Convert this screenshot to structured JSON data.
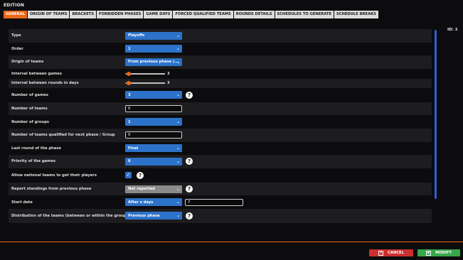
{
  "window": {
    "title": "EDITION",
    "id_text": "ID: 2"
  },
  "tabs": [
    {
      "label": "GENERAL",
      "active": true
    },
    {
      "label": "ORIGIN OF TEAMS"
    },
    {
      "label": "BRACKETS"
    },
    {
      "label": "FORBIDDEN PHASES"
    },
    {
      "label": "GAME DAYS"
    },
    {
      "label": "FORCED QUALIFIED TEAMS"
    },
    {
      "label": "ROUNDS DETAILS"
    },
    {
      "label": "SCHEDULES TO GENERATE"
    },
    {
      "label": "SCHEDULE BREAKS"
    }
  ],
  "form": {
    "type": {
      "label": "Type",
      "value": "Playoffs"
    },
    "order": {
      "label": "Order",
      "value": "1"
    },
    "origin": {
      "label": "Origin of teams",
      "value": "From previous phase (..."
    },
    "interval_games": {
      "label": "Interval between games",
      "value": "3",
      "level": 0.07
    },
    "interval_rounds": {
      "label": "Interval between rounds in days",
      "value": "3",
      "level": 0.07
    },
    "num_games": {
      "label": "Number of games",
      "value": "3"
    },
    "num_teams": {
      "label": "Number of teams",
      "value": "0"
    },
    "num_groups": {
      "label": "Number of groups",
      "value": "1"
    },
    "qualified": {
      "label": "Number of teams qualified for next phase / Group",
      "value": "0"
    },
    "last_round": {
      "label": "Last round of the phase",
      "value": "Final"
    },
    "priority": {
      "label": "Priority of the games",
      "value": "6"
    },
    "national": {
      "label": "Allow national teams to get their players",
      "checked": true
    },
    "standings": {
      "label": "Report standings from previous phase",
      "value": "Not reported"
    },
    "start_date": {
      "label": "Start date",
      "value": "After x days",
      "days": "7"
    },
    "distribution": {
      "label": "Distribution of the teams (between or within the groups)",
      "value": "Previous phase"
    }
  },
  "footer": {
    "cancel_label": "CANCEL",
    "modify_label": "MODIFY"
  },
  "colors": {
    "accent": "#e9681a",
    "select": "#2c72c9",
    "cancel": "#cc2f2f",
    "modify": "#38a64a",
    "scrollbar": "#2f5ed9"
  }
}
